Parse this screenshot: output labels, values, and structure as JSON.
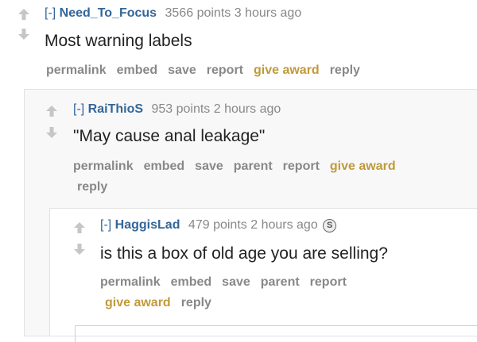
{
  "comments": [
    {
      "toggle": "[-]",
      "author": "Need_To_Focus",
      "score": "3566 points",
      "time": "3 hours ago",
      "body": "Most warning labels",
      "buttons": [
        "permalink",
        "embed",
        "save",
        "report",
        "give award",
        "reply"
      ]
    },
    {
      "toggle": "[-]",
      "author": "RaiThioS",
      "score": "953 points",
      "time": "2 hours ago",
      "body": "\"May cause anal leakage\"",
      "buttons": [
        "permalink",
        "embed",
        "save",
        "parent",
        "report",
        "give award",
        "reply"
      ]
    },
    {
      "toggle": "[-]",
      "author": "HaggisLad",
      "score": "479 points",
      "time": "2 hours ago",
      "award_icon": "S",
      "body": "is this a box of old age you are selling?",
      "buttons": [
        "permalink",
        "embed",
        "save",
        "parent",
        "report",
        "give award",
        "reply"
      ]
    }
  ],
  "colors": {
    "author": "#336699",
    "award": "#c09a3a",
    "muted": "#888888",
    "box_bg": "#f8f8f8"
  }
}
